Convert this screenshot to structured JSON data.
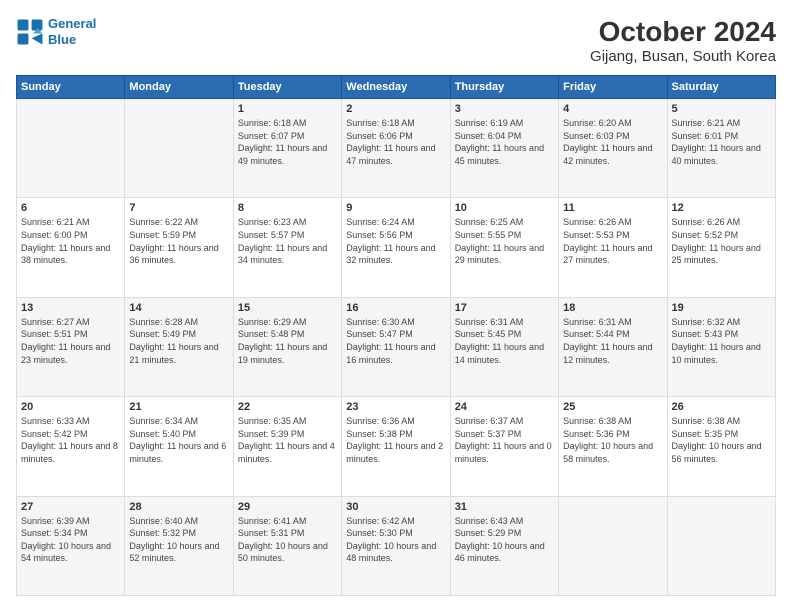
{
  "header": {
    "logo_line1": "General",
    "logo_line2": "Blue",
    "main_title": "October 2024",
    "subtitle": "Gijang, Busan, South Korea"
  },
  "weekdays": [
    "Sunday",
    "Monday",
    "Tuesday",
    "Wednesday",
    "Thursday",
    "Friday",
    "Saturday"
  ],
  "weeks": [
    [
      {
        "day": "",
        "info": ""
      },
      {
        "day": "",
        "info": ""
      },
      {
        "day": "1",
        "info": "Sunrise: 6:18 AM\nSunset: 6:07 PM\nDaylight: 11 hours and 49 minutes."
      },
      {
        "day": "2",
        "info": "Sunrise: 6:18 AM\nSunset: 6:06 PM\nDaylight: 11 hours and 47 minutes."
      },
      {
        "day": "3",
        "info": "Sunrise: 6:19 AM\nSunset: 6:04 PM\nDaylight: 11 hours and 45 minutes."
      },
      {
        "day": "4",
        "info": "Sunrise: 6:20 AM\nSunset: 6:03 PM\nDaylight: 11 hours and 42 minutes."
      },
      {
        "day": "5",
        "info": "Sunrise: 6:21 AM\nSunset: 6:01 PM\nDaylight: 11 hours and 40 minutes."
      }
    ],
    [
      {
        "day": "6",
        "info": "Sunrise: 6:21 AM\nSunset: 6:00 PM\nDaylight: 11 hours and 38 minutes."
      },
      {
        "day": "7",
        "info": "Sunrise: 6:22 AM\nSunset: 5:59 PM\nDaylight: 11 hours and 36 minutes."
      },
      {
        "day": "8",
        "info": "Sunrise: 6:23 AM\nSunset: 5:57 PM\nDaylight: 11 hours and 34 minutes."
      },
      {
        "day": "9",
        "info": "Sunrise: 6:24 AM\nSunset: 5:56 PM\nDaylight: 11 hours and 32 minutes."
      },
      {
        "day": "10",
        "info": "Sunrise: 6:25 AM\nSunset: 5:55 PM\nDaylight: 11 hours and 29 minutes."
      },
      {
        "day": "11",
        "info": "Sunrise: 6:26 AM\nSunset: 5:53 PM\nDaylight: 11 hours and 27 minutes."
      },
      {
        "day": "12",
        "info": "Sunrise: 6:26 AM\nSunset: 5:52 PM\nDaylight: 11 hours and 25 minutes."
      }
    ],
    [
      {
        "day": "13",
        "info": "Sunrise: 6:27 AM\nSunset: 5:51 PM\nDaylight: 11 hours and 23 minutes."
      },
      {
        "day": "14",
        "info": "Sunrise: 6:28 AM\nSunset: 5:49 PM\nDaylight: 11 hours and 21 minutes."
      },
      {
        "day": "15",
        "info": "Sunrise: 6:29 AM\nSunset: 5:48 PM\nDaylight: 11 hours and 19 minutes."
      },
      {
        "day": "16",
        "info": "Sunrise: 6:30 AM\nSunset: 5:47 PM\nDaylight: 11 hours and 16 minutes."
      },
      {
        "day": "17",
        "info": "Sunrise: 6:31 AM\nSunset: 5:45 PM\nDaylight: 11 hours and 14 minutes."
      },
      {
        "day": "18",
        "info": "Sunrise: 6:31 AM\nSunset: 5:44 PM\nDaylight: 11 hours and 12 minutes."
      },
      {
        "day": "19",
        "info": "Sunrise: 6:32 AM\nSunset: 5:43 PM\nDaylight: 11 hours and 10 minutes."
      }
    ],
    [
      {
        "day": "20",
        "info": "Sunrise: 6:33 AM\nSunset: 5:42 PM\nDaylight: 11 hours and 8 minutes."
      },
      {
        "day": "21",
        "info": "Sunrise: 6:34 AM\nSunset: 5:40 PM\nDaylight: 11 hours and 6 minutes."
      },
      {
        "day": "22",
        "info": "Sunrise: 6:35 AM\nSunset: 5:39 PM\nDaylight: 11 hours and 4 minutes."
      },
      {
        "day": "23",
        "info": "Sunrise: 6:36 AM\nSunset: 5:38 PM\nDaylight: 11 hours and 2 minutes."
      },
      {
        "day": "24",
        "info": "Sunrise: 6:37 AM\nSunset: 5:37 PM\nDaylight: 11 hours and 0 minutes."
      },
      {
        "day": "25",
        "info": "Sunrise: 6:38 AM\nSunset: 5:36 PM\nDaylight: 10 hours and 58 minutes."
      },
      {
        "day": "26",
        "info": "Sunrise: 6:38 AM\nSunset: 5:35 PM\nDaylight: 10 hours and 56 minutes."
      }
    ],
    [
      {
        "day": "27",
        "info": "Sunrise: 6:39 AM\nSunset: 5:34 PM\nDaylight: 10 hours and 54 minutes."
      },
      {
        "day": "28",
        "info": "Sunrise: 6:40 AM\nSunset: 5:32 PM\nDaylight: 10 hours and 52 minutes."
      },
      {
        "day": "29",
        "info": "Sunrise: 6:41 AM\nSunset: 5:31 PM\nDaylight: 10 hours and 50 minutes."
      },
      {
        "day": "30",
        "info": "Sunrise: 6:42 AM\nSunset: 5:30 PM\nDaylight: 10 hours and 48 minutes."
      },
      {
        "day": "31",
        "info": "Sunrise: 6:43 AM\nSunset: 5:29 PM\nDaylight: 10 hours and 46 minutes."
      },
      {
        "day": "",
        "info": ""
      },
      {
        "day": "",
        "info": ""
      }
    ]
  ]
}
